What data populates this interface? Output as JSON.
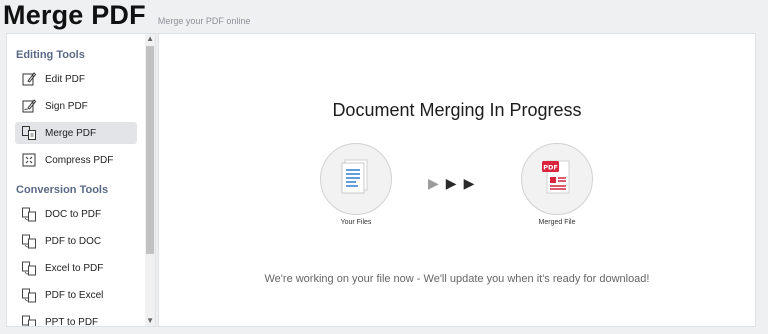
{
  "header": {
    "title": "Merge PDF",
    "subtitle": "Merge your PDF online"
  },
  "sidebar": {
    "sections": [
      {
        "title": "Editing Tools",
        "items": [
          {
            "label": "Edit PDF",
            "icon": "edit-pdf-icon"
          },
          {
            "label": "Sign PDF",
            "icon": "sign-pdf-icon"
          },
          {
            "label": "Merge PDF",
            "icon": "merge-pdf-icon",
            "active": true
          },
          {
            "label": "Compress PDF",
            "icon": "compress-pdf-icon"
          }
        ]
      },
      {
        "title": "Conversion Tools",
        "items": [
          {
            "label": "DOC to PDF",
            "icon": "convert-icon"
          },
          {
            "label": "PDF to DOC",
            "icon": "convert-icon"
          },
          {
            "label": "Excel to PDF",
            "icon": "convert-icon"
          },
          {
            "label": "PDF to Excel",
            "icon": "convert-icon"
          },
          {
            "label": "PPT to PDF",
            "icon": "convert-icon"
          }
        ]
      }
    ]
  },
  "main": {
    "heading": "Document Merging In Progress",
    "source_label": "Your Files",
    "target_label": "Merged File",
    "pdf_badge": "PDF",
    "status": "We're working on your file now - We'll update you when it's ready for download!"
  },
  "colors": {
    "active_item_bg": "#e2e4e7",
    "section_title": "#5a6a86",
    "file_icon_blue": "#2f7fd1",
    "pdf_red": "#d9243d"
  }
}
